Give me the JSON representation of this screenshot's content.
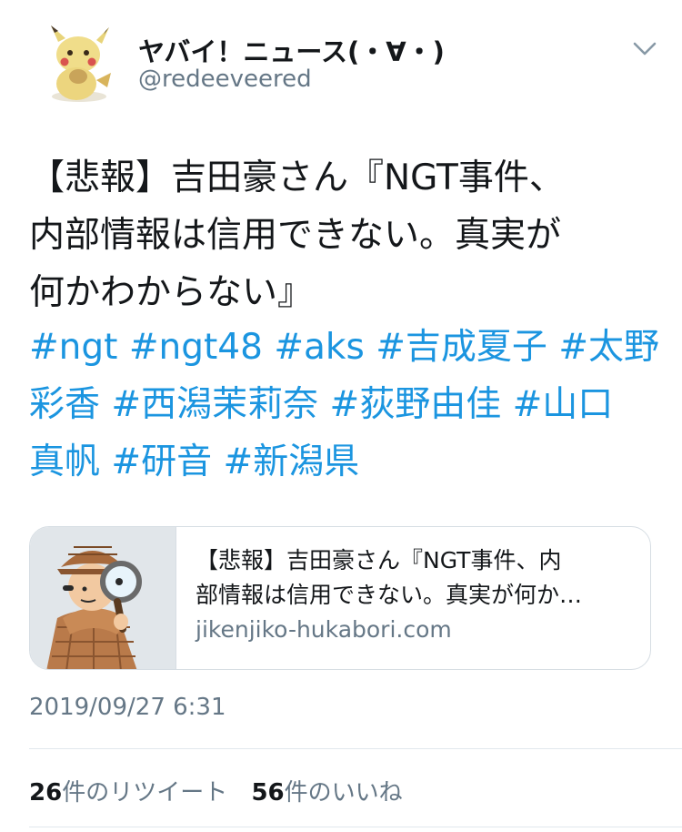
{
  "user": {
    "display_name": "ヤバイ！ニュース(・∀・)",
    "handle": "@redeeveered"
  },
  "tweet": {
    "text_lines": [
      "【悲報】吉田豪さん『NGT事件、",
      "内部情報は信用できない。真実が",
      "何かわからない』"
    ],
    "hashtag_lines": [
      [
        "#ngt",
        "#ngt48",
        "#aks",
        "#吉成夏子",
        "#太野"
      ],
      [
        "彩香",
        "#西潟茉莉奈",
        "#荻野由佳",
        "#山口"
      ],
      [
        "真帆",
        "#研音",
        "#新潟県"
      ]
    ]
  },
  "card": {
    "title_lines": [
      "【悲報】吉田豪さん『NGT事件、内",
      "部情報は信用できない。真実が何か…"
    ],
    "domain": "jikenjiko-hukabori.com",
    "image_icon": "detective-with-magnifier-illustration"
  },
  "timestamp": "2019/09/27 6:31",
  "stats": {
    "retweets_count": "26",
    "retweets_label": "件のリツイート",
    "likes_count": "56",
    "likes_label": "件のいいね"
  },
  "icons": {
    "avatar": "pikachu-plush-avatar",
    "menu": "chevron-down-icon"
  },
  "colors": {
    "link": "#1b95e0",
    "secondary_text": "#657786",
    "primary_text": "#14171a",
    "border": "#d6dde3"
  }
}
